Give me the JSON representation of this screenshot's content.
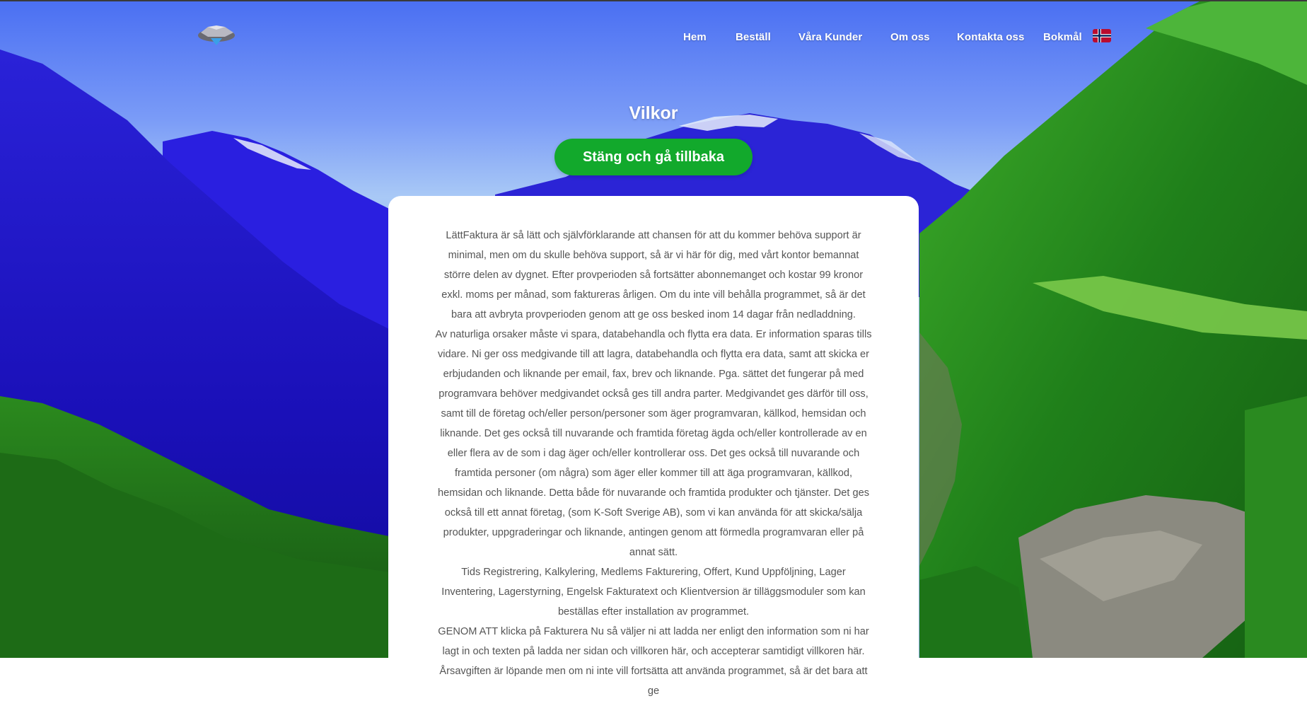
{
  "nav": {
    "logo_alt": "logo",
    "items": [
      {
        "label": "Hem"
      },
      {
        "label": "Beställ"
      },
      {
        "label": "Våra Kunder"
      },
      {
        "label": "Om oss"
      },
      {
        "label": "Kontakta oss"
      },
      {
        "label": "Bokmål"
      }
    ],
    "flag_icon": "norway-flag-icon"
  },
  "page": {
    "title": "Vilkor",
    "back_button": "Stäng och gå tillbaka"
  },
  "terms": {
    "paragraphs": [
      "LättFaktura är så lätt och självförklarande att chansen för att du kommer behöva support är minimal, men om du skulle behöva support, så är vi här för dig, med vårt kontor bemannat större delen av dygnet. Efter provperioden så fortsätter abonnemanget och kostar 99 kronor exkl. moms per månad, som faktureras årligen. Om du inte vill behålla programmet, så är det bara att avbryta provperioden genom att ge oss besked inom 14 dagar från nedladdning.",
      "Av naturliga orsaker måste vi spara, databehandla och flytta era data. Er information sparas tills vidare. Ni ger oss medgivande till att lagra, databehandla och flytta era data, samt att skicka er erbjudanden och liknande per email, fax, brev och liknande. Pga. sättet det fungerar på med programvara behöver medgivandet också ges till andra parter. Medgivandet ges därför till oss, samt till de företag och/eller person/personer som äger programvaran, källkod, hemsidan och liknande. Det ges också till nuvarande och framtida företag ägda och/eller kontrollerade av en eller flera av de som i dag äger och/eller kontrollerar oss. Det ges också till nuvarande och framtida personer (om några) som äger eller kommer till att äga programvaran, källkod, hemsidan och liknande. Detta både för nuvarande och framtida produkter och tjänster. Det ges också till ett annat företag, (som K-Soft Sverige AB), som vi kan använda för att skicka/sälja produkter, uppgraderingar och liknande, antingen genom att förmedla programvaran eller på annat sätt.",
      "Tids Registrering, Kalkylering, Medlems Fakturering, Offert, Kund Uppföljning, Lager Inventering, Lagerstyrning, Engelsk Fakturatext och Klientversion är tilläggsmoduler som kan beställas efter installation av programmet.",
      "GENOM ATT klicka på Fakturera Nu så väljer ni att ladda ner enligt den information som ni har lagt in och texten på ladda ner sidan och villkoren här, och accepterar samtidigt villkoren här.",
      "Årsavgiften är löpande men om ni inte vill fortsätta att använda programmet, så är det bara att ge"
    ]
  }
}
